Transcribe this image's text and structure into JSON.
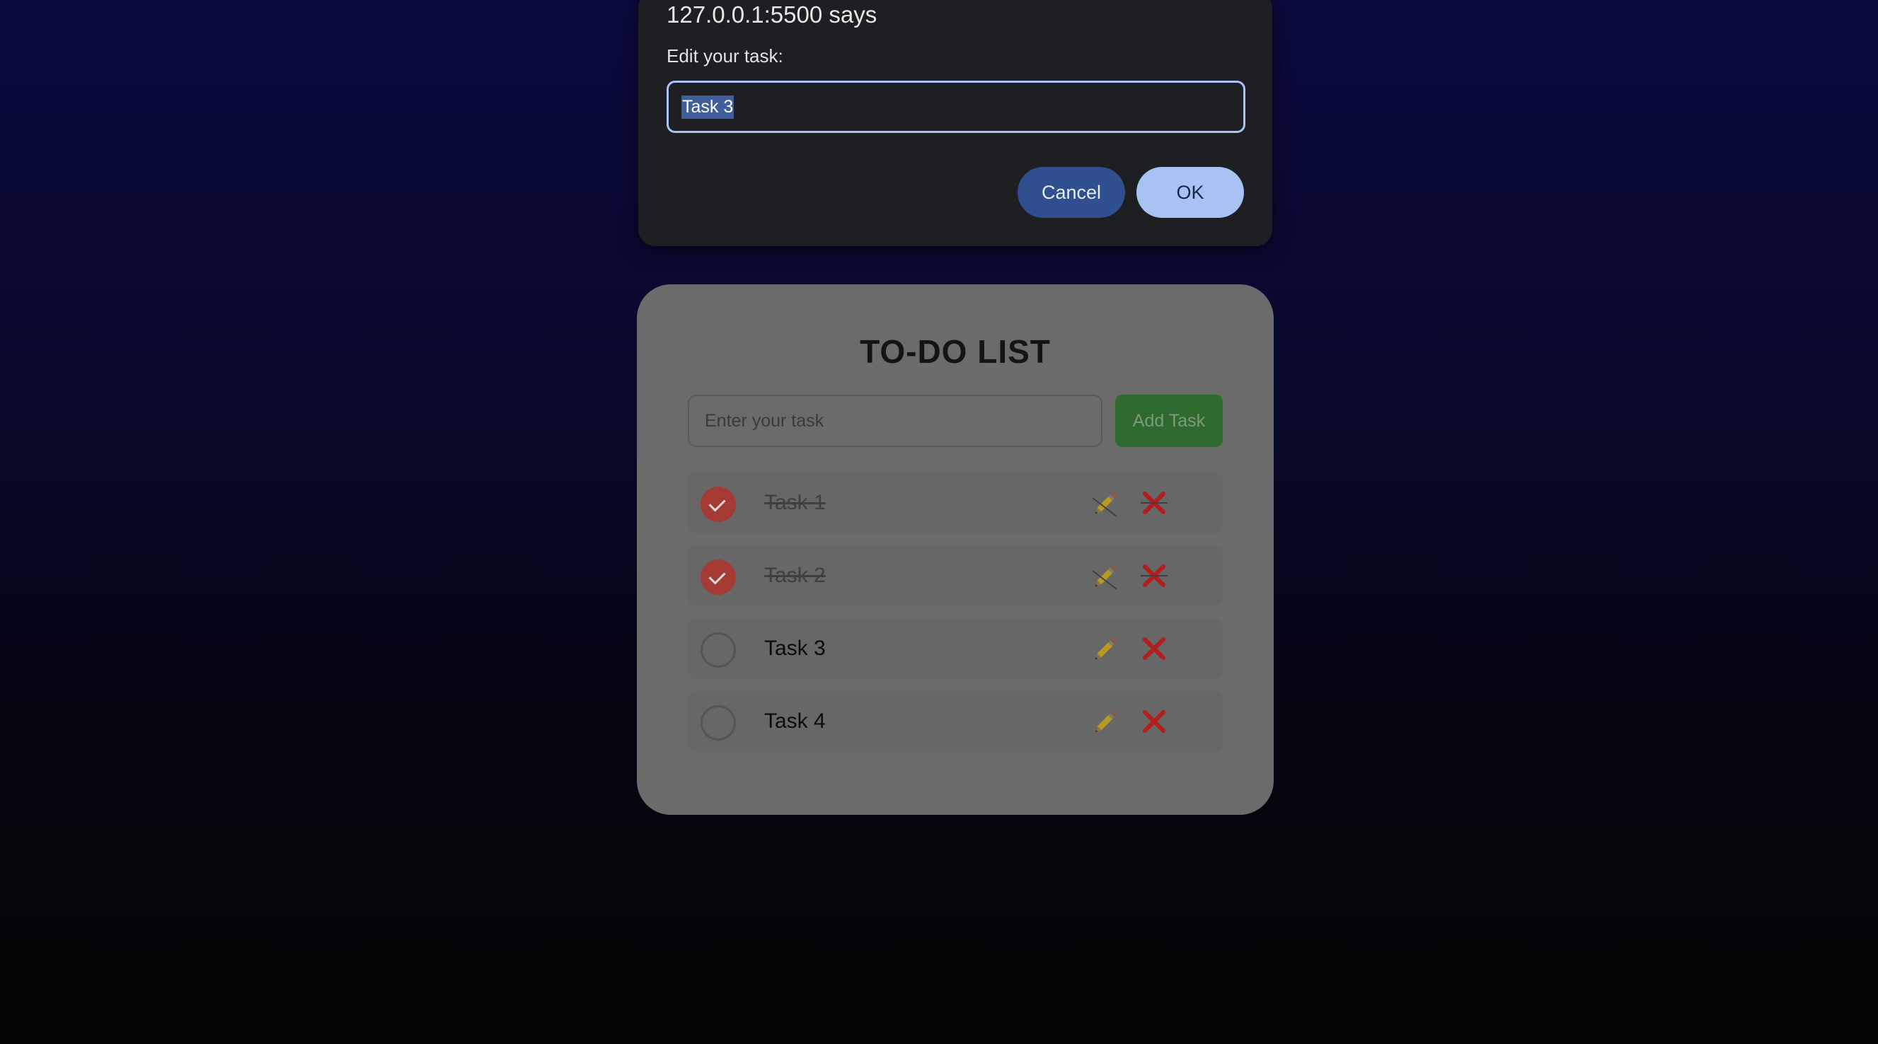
{
  "dialog": {
    "title": "127.0.0.1:5500 says",
    "message": "Edit your task:",
    "input_value": "Task 3",
    "cancel_label": "Cancel",
    "ok_label": "OK"
  },
  "todo": {
    "title": "TO-DO LIST",
    "input_placeholder": "Enter your task",
    "add_button_label": "Add Task",
    "tasks": [
      {
        "text": "Task 1",
        "completed": true
      },
      {
        "text": "Task 2",
        "completed": true
      },
      {
        "text": "Task 3",
        "completed": false
      },
      {
        "text": "Task 4",
        "completed": false
      }
    ],
    "icons": {
      "edit": "pencil-icon",
      "delete": "close-icon"
    }
  },
  "colors": {
    "completed_check": "#a33a33",
    "add_button": "#2e6a2d",
    "delete_icon": "#b01e1e",
    "dialog_accent": "#a8c3f3"
  }
}
